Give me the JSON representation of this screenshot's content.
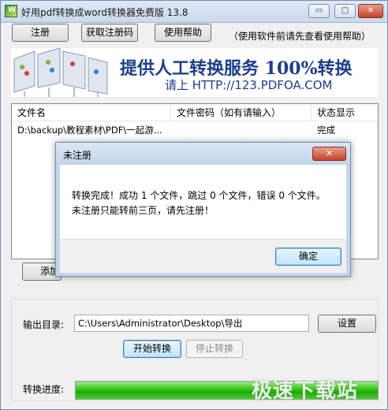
{
  "window": {
    "title": "好用pdf转换成word转换器免费版 13.8",
    "controls": {
      "minimize": "▭",
      "maximize": "□",
      "close": "✕"
    }
  },
  "toolbar": {
    "register": "注册",
    "get_code": "获取注册码",
    "help": "使用帮助",
    "hint": "（使用软件前请先查看使用帮助）"
  },
  "banner": {
    "title": "提供人工转换服务 100%转换",
    "subtitle": "请上  HTTP://123.PDFOA.COM"
  },
  "file_list": {
    "columns": [
      "文件名",
      "文件密码（如有请输入）",
      "状态显示"
    ],
    "rows": [
      {
        "name": "D:\\backup\\教程素材\\PDF\\一起游...",
        "password": "",
        "status": "完成"
      }
    ]
  },
  "add_button_partial": "添加",
  "output": {
    "label": "输出目录:",
    "path": "C:\\Users\\Administrator\\Desktop\\导出",
    "settings": "设置"
  },
  "actions": {
    "start": "开始转换",
    "stop": "停止转换"
  },
  "progress": {
    "label": "转换进度:",
    "value": 1.0
  },
  "watermark": "极速下载站",
  "dialog": {
    "title": "未注册",
    "close": "✕",
    "line1": "转换完成！成功 1 个文件，跳过 0 个文件，错误 0 个文件。",
    "line2": "未注册只能转前三页，请先注册！",
    "ok": "确定"
  },
  "colors": {
    "accent": "#1e3e8a",
    "progress": "#1fa80a",
    "close": "#c7402a"
  }
}
